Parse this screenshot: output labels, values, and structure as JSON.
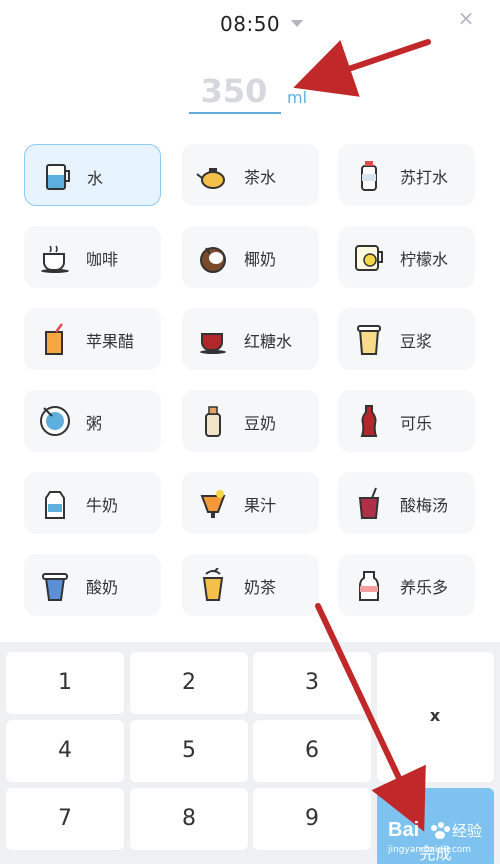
{
  "header": {
    "time": "08:50",
    "close_label": "×"
  },
  "amount": {
    "value": "350",
    "unit": "ml"
  },
  "drinks": [
    {
      "label": "水",
      "icon": "water-glass-icon",
      "selected": true
    },
    {
      "label": "茶水",
      "icon": "teapot-icon"
    },
    {
      "label": "苏打水",
      "icon": "soda-bottle-icon"
    },
    {
      "label": "咖啡",
      "icon": "coffee-cup-icon"
    },
    {
      "label": "椰奶",
      "icon": "coconut-icon"
    },
    {
      "label": "柠檬水",
      "icon": "lemon-water-icon"
    },
    {
      "label": "苹果醋",
      "icon": "apple-vinegar-icon"
    },
    {
      "label": "红糖水",
      "icon": "brown-sugar-water-icon"
    },
    {
      "label": "豆浆",
      "icon": "soy-milk-cup-icon"
    },
    {
      "label": "粥",
      "icon": "porridge-bowl-icon"
    },
    {
      "label": "豆奶",
      "icon": "soy-milk-bottle-icon"
    },
    {
      "label": "可乐",
      "icon": "cola-bottle-icon"
    },
    {
      "label": "牛奶",
      "icon": "milk-carton-icon"
    },
    {
      "label": "果汁",
      "icon": "juice-glass-icon"
    },
    {
      "label": "酸梅汤",
      "icon": "plum-drink-icon"
    },
    {
      "label": "酸奶",
      "icon": "yogurt-icon"
    },
    {
      "label": "奶茶",
      "icon": "milk-tea-icon"
    },
    {
      "label": "养乐多",
      "icon": "yakult-icon"
    }
  ],
  "keypad": {
    "keys": [
      "1",
      "2",
      "3",
      "4",
      "5",
      "6",
      "7",
      "8",
      "9"
    ],
    "backspace_label": "x",
    "done_label": "完成"
  },
  "watermark": {
    "brand": "Bai",
    "suffix": "经验",
    "url": "jingyan.baidu.com"
  },
  "colors": {
    "accent": "#5db0de",
    "selected_bg": "#e8f4fd",
    "tile_bg": "#f6f7f9",
    "done": "#7ec3ef",
    "annotation_arrow": "#c0282a"
  }
}
